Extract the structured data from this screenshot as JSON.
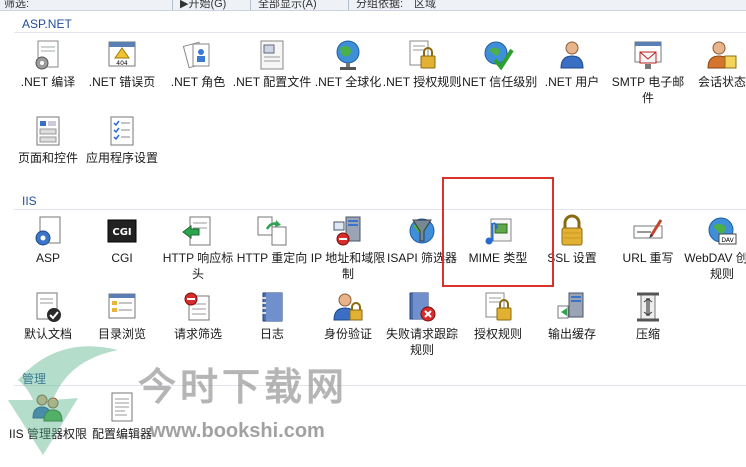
{
  "toolbar": {
    "items": [
      "筛选:",
      "▶开始(G)",
      "全部显示(A)",
      "分组依据:",
      "区域"
    ]
  },
  "sections": [
    {
      "title": "ASP.NET",
      "items": [
        {
          "label": ".NET 编译",
          "icon": "net-compile-icon"
        },
        {
          "label": ".NET 错误页",
          "icon": "error-page-404-icon"
        },
        {
          "label": ".NET 角色",
          "icon": "net-roles-icon"
        },
        {
          "label": ".NET 配置文件",
          "icon": "net-profile-icon"
        },
        {
          "label": ".NET 全球化",
          "icon": "globe-icon"
        },
        {
          "label": ".NET 授权规则",
          "icon": "lock-document-icon"
        },
        {
          "label": ".NET 信任级别",
          "icon": "trust-level-icon"
        },
        {
          "label": ".NET 用户",
          "icon": "user-icon"
        },
        {
          "label": "SMTP 电子邮件",
          "icon": "smtp-email-icon"
        },
        {
          "label": "会话状态",
          "icon": "session-state-icon"
        },
        {
          "label": "页面和控件",
          "icon": "pages-controls-icon"
        },
        {
          "label": "应用程序设置",
          "icon": "app-settings-icon"
        }
      ]
    },
    {
      "title": "IIS",
      "items": [
        {
          "label": "ASP",
          "icon": "asp-icon"
        },
        {
          "label": "CGI",
          "icon": "cgi-icon"
        },
        {
          "label": "HTTP 响应标头",
          "icon": "http-headers-icon"
        },
        {
          "label": "HTTP 重定向",
          "icon": "http-redirect-icon"
        },
        {
          "label": "IP 地址和域限制",
          "icon": "ip-restrictions-icon"
        },
        {
          "label": "ISAPI 筛选器",
          "icon": "isapi-filter-icon"
        },
        {
          "label": "MIME 类型",
          "icon": "mime-types-icon"
        },
        {
          "label": "SSL 设置",
          "icon": "ssl-lock-icon"
        },
        {
          "label": "URL 重写",
          "icon": "url-rewrite-icon"
        },
        {
          "label": "WebDAV 创作规则",
          "icon": "webdav-icon"
        },
        {
          "label": "默认文档",
          "icon": "default-document-icon"
        },
        {
          "label": "目录浏览",
          "icon": "directory-browsing-icon"
        },
        {
          "label": "请求筛选",
          "icon": "request-filtering-icon"
        },
        {
          "label": "日志",
          "icon": "logging-icon"
        },
        {
          "label": "身份验证",
          "icon": "authentication-icon"
        },
        {
          "label": "失败请求跟踪规则",
          "icon": "failed-request-tracing-icon"
        },
        {
          "label": "授权规则",
          "icon": "authorization-rules-icon"
        },
        {
          "label": "输出缓存",
          "icon": "output-caching-icon"
        },
        {
          "label": "压缩",
          "icon": "compression-icon"
        }
      ]
    },
    {
      "title": "管理",
      "items": [
        {
          "label": "IIS 管理器权限",
          "icon": "iis-manager-permissions-icon"
        },
        {
          "label": "配置编辑器",
          "icon": "configuration-editor-icon"
        }
      ]
    }
  ],
  "watermark": {
    "text": "今时下载网",
    "url": "www.bookshi.com"
  },
  "colors": {
    "section_title": "#1f4e9a",
    "highlight_border": "#d9312b"
  }
}
